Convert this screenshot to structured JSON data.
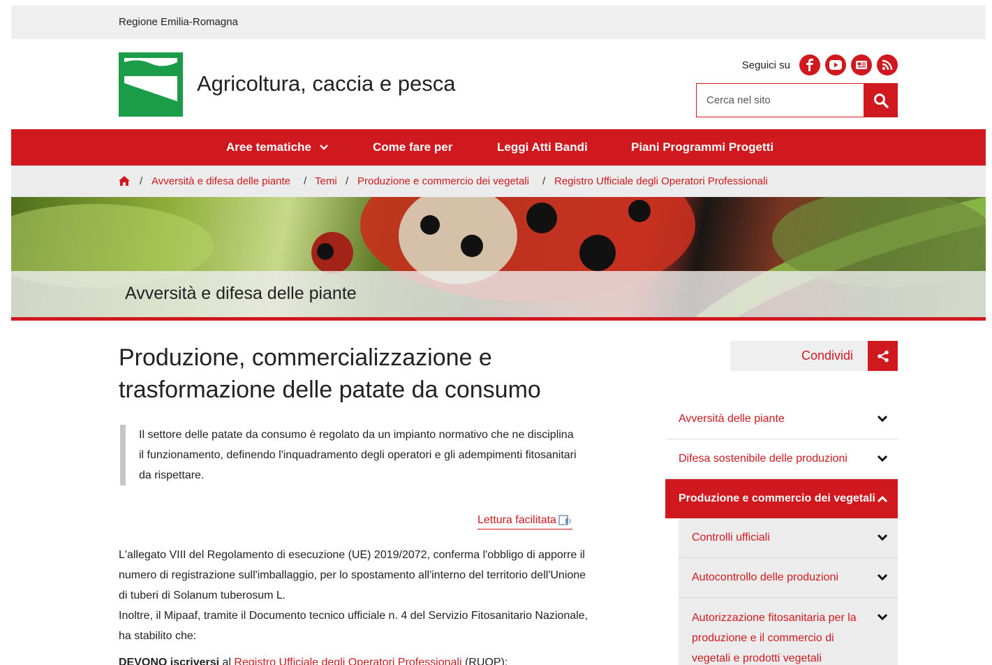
{
  "topbar": {
    "region": "Regione Emilia-Romagna"
  },
  "header": {
    "site_title": "Agricoltura, caccia e pesca",
    "follow_label": "Seguici su",
    "social": [
      "facebook-icon",
      "youtube-icon",
      "newsletter-icon",
      "rss-icon"
    ],
    "search_placeholder": "Cerca nel sito"
  },
  "nav": {
    "items": [
      "Aree tematiche",
      "Come fare per",
      "Leggi Atti Bandi",
      "Piani Programmi Progetti"
    ]
  },
  "breadcrumb": {
    "items": [
      "Avversità e difesa delle piante",
      "Temi",
      "Produzione e commercio dei vegetali",
      "Registro Ufficiale degli Operatori Professionali"
    ]
  },
  "hero": {
    "title": "Avversità e difesa delle piante"
  },
  "main": {
    "title": "Produzione, commercializzazione e trasformazione delle patate da consumo",
    "lead": "Il settore delle patate da consumo è regolato da un impianto normativo che ne disciplina il funzionamento, definendo l'inquadramento degli operatori e gli adempimenti fitosanitari da rispettare.",
    "easy_read": "Lettura facilitata",
    "p1": "L'allegato VIII del Regolamento di esecuzione (UE) 2019/2072, conferma l'obbligo di apporre il numero di  registrazione sull'imballaggio, per lo spostamento all'interno del territorio dell'Unione di tuberi di Solanum tuberosum L.",
    "p2": "Inoltre, il Mipaaf, tramite il Documento tecnico ufficiale n. 4 del Servizio Fitosanitario Nazionale, ha stabilito che:",
    "p3_bold": "DEVONO iscriversi",
    "p3_a": " al ",
    "p3_link": "Registro Ufficiale degli Operatori Professionali",
    "p3_b": " (RUOP):"
  },
  "share": {
    "label": "Condividi"
  },
  "sidebar": {
    "items": [
      {
        "label": "Avversità delle piante",
        "state": "collapsed"
      },
      {
        "label": "Difesa sostenibile delle produzioni",
        "state": "collapsed"
      },
      {
        "label": "Produzione e commercio dei vegetali",
        "state": "expanded"
      }
    ],
    "sub_items": [
      "Controlli ufficiali",
      "Autocontrollo delle produzioni",
      "Autorizzazione fitosanitaria per la produzione e il commercio di vegetali e prodotti vegetali"
    ]
  },
  "colors": {
    "brand_red": "#d0191e",
    "logo_green": "#1b9c48",
    "bar_gray": "#efefef"
  }
}
